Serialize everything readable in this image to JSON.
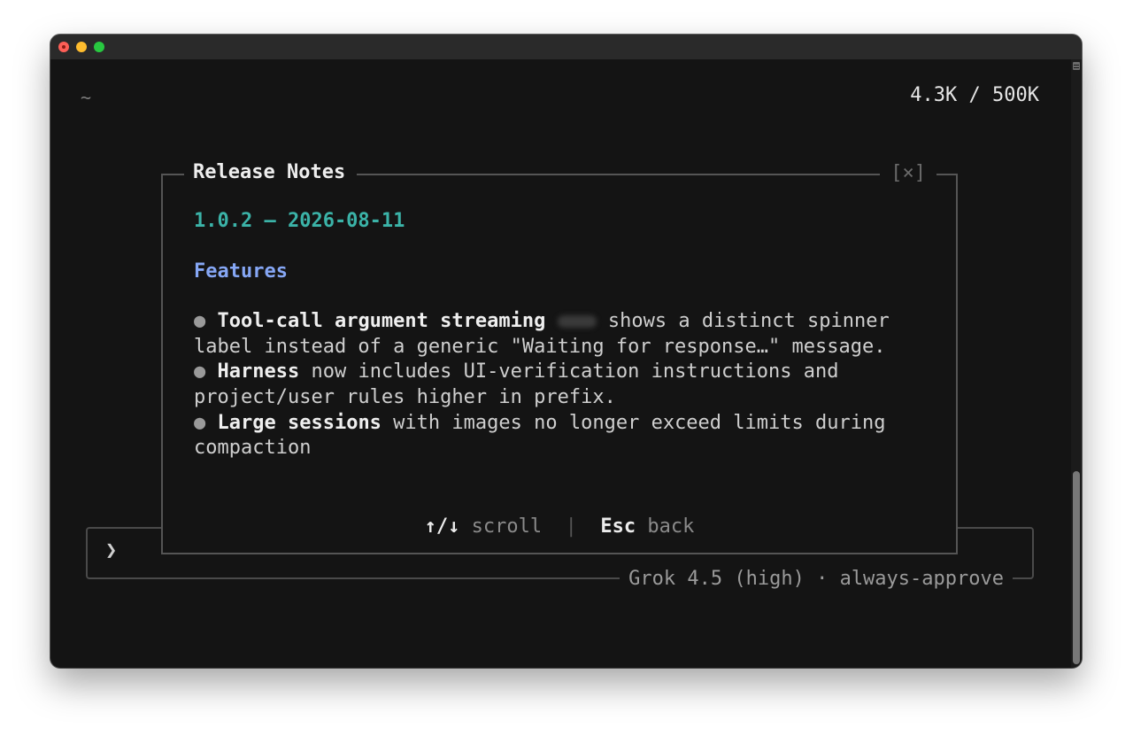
{
  "header": {
    "cwd": "~",
    "token_usage": "4.3K / 500K"
  },
  "dialog": {
    "title": "Release Notes",
    "close_label": "[×]",
    "version_line": "1.0.2 — 2026-08-11",
    "section_title": "Features",
    "notes": [
      {
        "bullet": "●",
        "bold": "Tool-call argument streaming",
        "text": " shows a distinct spinner label instead of a generic \"Waiting for response…\" message."
      },
      {
        "bullet": "●",
        "bold": "Harness",
        "text": " now includes UI-verification instructions and project/user rules higher in prefix."
      },
      {
        "bullet": "●",
        "bold": "Large sessions",
        "text": " with images no longer exceed limits during compaction"
      }
    ],
    "footer": {
      "scroll_key": "↑/↓",
      "scroll_label": "scroll",
      "separator": "|",
      "back_key": "Esc",
      "back_label": "back"
    }
  },
  "input": {
    "prompt_symbol": "❯",
    "status": "Grok 4.5 (high) · always-approve"
  },
  "colors": {
    "version": "#3bb3a8",
    "section": "#86a7f5",
    "background": "#141414"
  }
}
